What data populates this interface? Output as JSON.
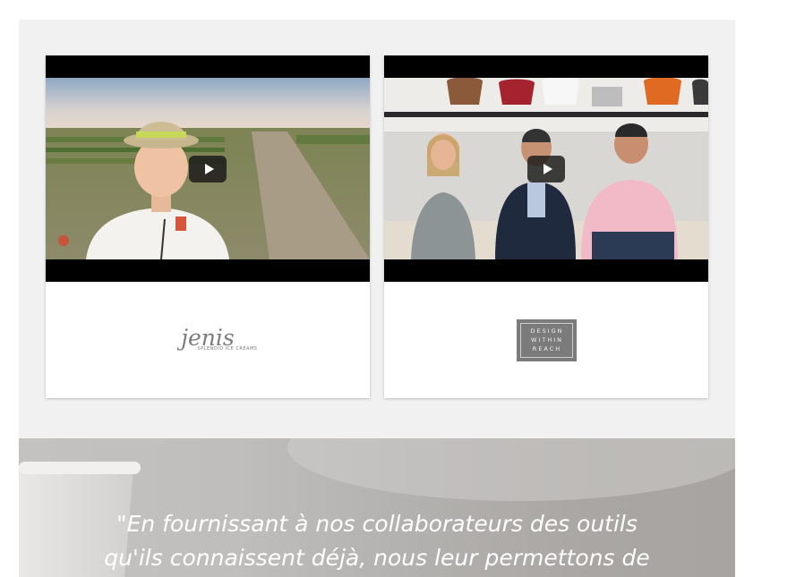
{
  "cards": [
    {
      "brand_name": "jenis",
      "brand_tagline": "SPLENDID ICE CREAMS",
      "play_icon": "play-icon"
    },
    {
      "brand_lines": [
        "DESIGN",
        "WITHIN",
        "REACH"
      ],
      "play_icon": "play-icon"
    }
  ],
  "testimonial": {
    "line1": "\"En fournissant à nos collaborateurs des outils",
    "line2": "qu'ils connaissent déjà, nous leur permettons de"
  },
  "colors": {
    "panel_bg": "#f1f1f1",
    "logo_gray": "#7b7b7b",
    "banner_text": "#ffffff"
  }
}
